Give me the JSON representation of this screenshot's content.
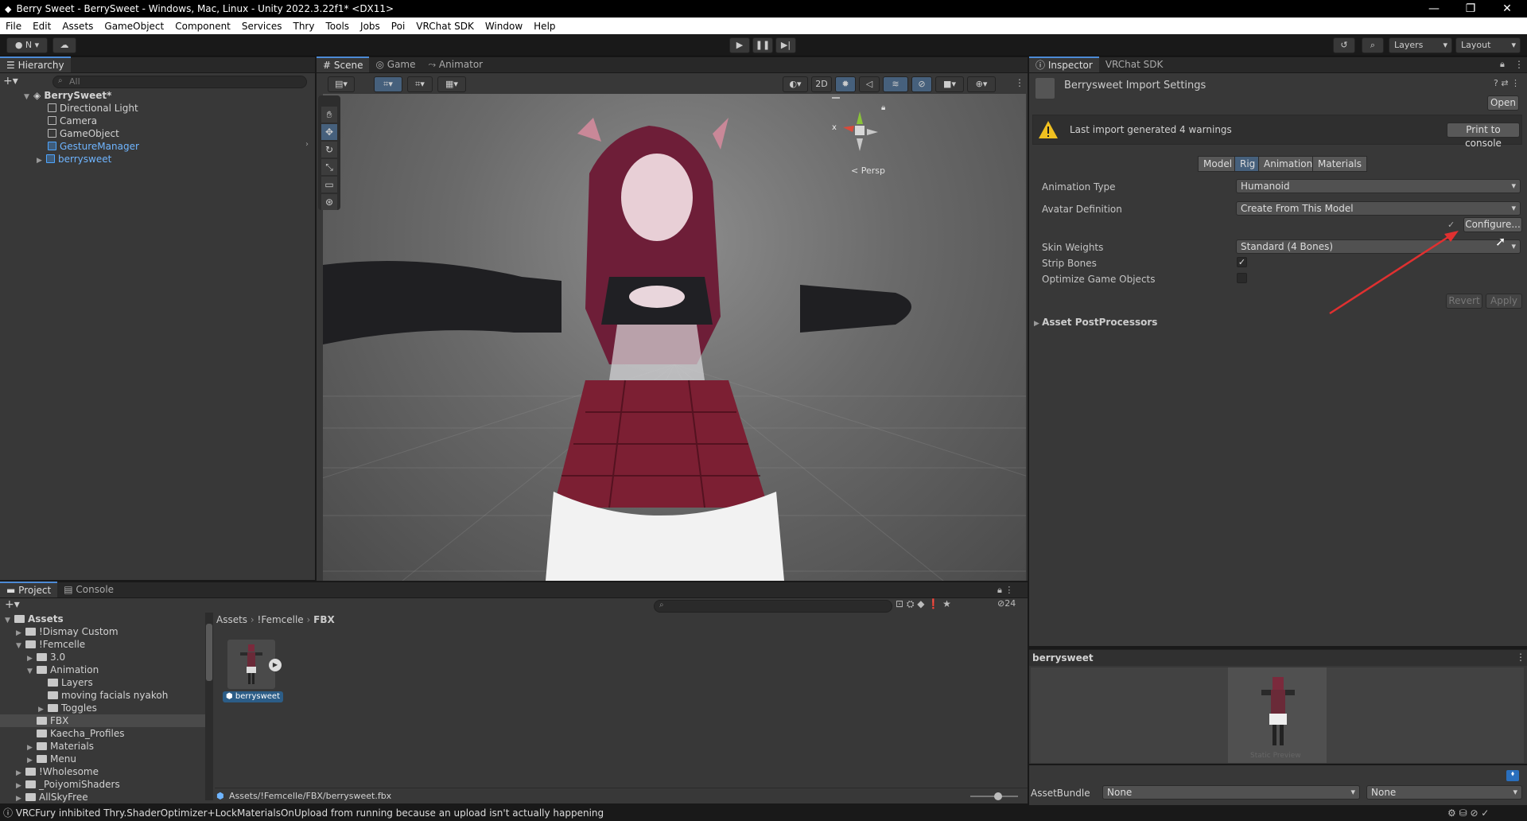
{
  "window": {
    "title": "Berry Sweet - BerrySweet - Windows, Mac, Linux - Unity 2022.3.22f1* <DX11>"
  },
  "menu": [
    "File",
    "Edit",
    "Assets",
    "GameObject",
    "Component",
    "Services",
    "Thry",
    "Tools",
    "Jobs",
    "Poi",
    "VRChat SDK",
    "Window",
    "Help"
  ],
  "toolbar": {
    "account_label": "N",
    "layers_label": "Layers",
    "layout_label": "Layout"
  },
  "hierarchy": {
    "tab": "Hierarchy",
    "search_placeholder": "All",
    "scene_name": "BerrySweet*",
    "items": [
      "Directional Light",
      "Camera",
      "GameObject",
      "GestureManager",
      "berrysweet"
    ]
  },
  "scene": {
    "tabs": [
      "Scene",
      "Game",
      "Animator"
    ],
    "mode_2d": "2D",
    "persp_label": "Persp",
    "gizmo_x": "x"
  },
  "inspector": {
    "tabs": [
      "Inspector",
      "VRChat SDK"
    ],
    "header_title": "Berrysweet Import Settings",
    "open_button": "Open",
    "warning_text": "Last import generated 4 warnings",
    "print_console_button": "Print to console",
    "rig_tabs": [
      "Model",
      "Rig",
      "Animation",
      "Materials"
    ],
    "selected_rig_tab": "Rig",
    "animation_type_label": "Animation Type",
    "animation_type_value": "Humanoid",
    "avatar_definition_label": "Avatar Definition",
    "avatar_definition_value": "Create From This Model",
    "configure_button": "Configure...",
    "skin_weights_label": "Skin Weights",
    "skin_weights_value": "Standard (4 Bones)",
    "strip_bones_label": "Strip Bones",
    "optimize_label": "Optimize Game Objects",
    "revert_button": "Revert",
    "apply_button": "Apply",
    "postprocessors_label": "Asset PostProcessors",
    "preview_title": "berrysweet",
    "preview_caption": "Static Preview",
    "assetbundle_label": "AssetBundle",
    "assetbundle_value": "None",
    "assetbundle_variant": "None"
  },
  "project": {
    "tabs": [
      "Project",
      "Console"
    ],
    "tree": [
      {
        "label": "Assets",
        "indent": 0,
        "arrow": "▼",
        "bold": true
      },
      {
        "label": "!Dismay Custom",
        "indent": 1,
        "arrow": "▶"
      },
      {
        "label": "!Femcelle",
        "indent": 1,
        "arrow": "▼"
      },
      {
        "label": "3.0",
        "indent": 2,
        "arrow": "▶"
      },
      {
        "label": "Animation",
        "indent": 2,
        "arrow": "▼"
      },
      {
        "label": "Layers",
        "indent": 3,
        "arrow": ""
      },
      {
        "label": "moving facials nyakoh",
        "indent": 3,
        "arrow": ""
      },
      {
        "label": "Toggles",
        "indent": 3,
        "arrow": "▶"
      },
      {
        "label": "FBX",
        "indent": 2,
        "arrow": "",
        "selected": true
      },
      {
        "label": "Kaecha_Profiles",
        "indent": 2,
        "arrow": ""
      },
      {
        "label": "Materials",
        "indent": 2,
        "arrow": "▶"
      },
      {
        "label": "Menu",
        "indent": 2,
        "arrow": "▶"
      },
      {
        "label": "!Wholesome",
        "indent": 1,
        "arrow": "▶"
      },
      {
        "label": "_PoiyomiShaders",
        "indent": 1,
        "arrow": "▶"
      },
      {
        "label": "AllSkyFree",
        "indent": 1,
        "arrow": "▶"
      }
    ],
    "breadcrumb": [
      "Assets",
      "!Femcelle",
      "FBX"
    ],
    "asset_name": "berrysweet",
    "path": "Assets/!Femcelle/FBX/berrysweet.fbx",
    "hidden_count": "24"
  },
  "status": {
    "message": "VRCFury inhibited Thry.ShaderOptimizer+LockMaterialsOnUpload from running because an upload isn't actually happening"
  },
  "colors": {
    "accent": "#4d8bd6",
    "selection": "#2c5d87",
    "arrow_annotation": "#e03030",
    "warning": "#f0c020"
  }
}
